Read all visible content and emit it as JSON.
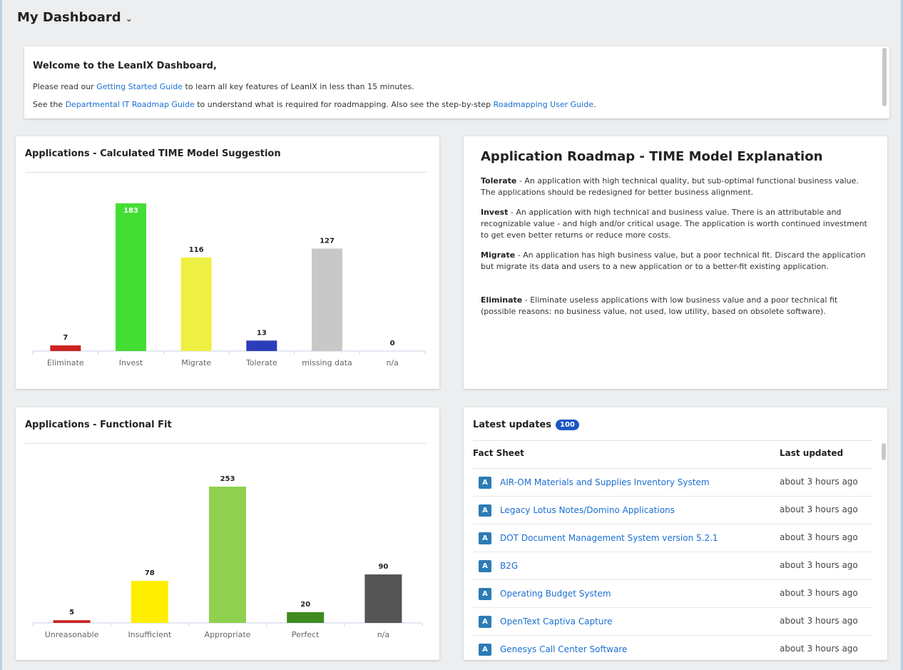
{
  "header": {
    "title": "My Dashboard",
    "chevron_icon": "chevron-down-icon"
  },
  "welcome": {
    "title": "Welcome to the LeanIX Dashboard,",
    "line1_pre": "Please read our ",
    "line1_link": "Getting Started Guide",
    "line1_post": " to learn all key features of LeanIX in less than 15 minutes.",
    "line2_pre": "See the ",
    "line2_link1": "Departmental IT Roadmap Guide",
    "line2_mid": " to understand what is required for roadmapping. Also see the step-by-step ",
    "line2_link2": "Roadmapping User Guide",
    "line2_post": "."
  },
  "time_chart": {
    "title": "Applications - Calculated TIME Model Suggestion"
  },
  "ff_chart": {
    "title": "Applications - Functional Fit"
  },
  "chart_data": [
    {
      "type": "bar",
      "title": "Applications - Calculated TIME Model Suggestion",
      "categories": [
        "Eliminate",
        "Invest",
        "Migrate",
        "Tolerate",
        "missing data",
        "n/a"
      ],
      "values": [
        7,
        183,
        116,
        13,
        127,
        0
      ],
      "colors": [
        "#cc2222",
        "#44dd33",
        "#eef044",
        "#2c3dbb",
        "#c8c8c8",
        "#c8c8c8"
      ],
      "ylim": [
        0,
        183
      ]
    },
    {
      "type": "bar",
      "title": "Applications - Functional Fit",
      "categories": [
        "Unreasonable",
        "Insufficient",
        "Appropriate",
        "Perfect",
        "n/a"
      ],
      "values": [
        5,
        78,
        253,
        20,
        90
      ],
      "colors": [
        "#cc2222",
        "#ffee00",
        "#8fd14f",
        "#3f8a1f",
        "#555555"
      ],
      "ylim": [
        0,
        253
      ]
    }
  ],
  "explain": {
    "title": "Application Roadmap - TIME Model Explanation",
    "items": [
      {
        "term": "Tolerate",
        "text": " - An application with high technical quality, but sub-optimal functional business value. The applications should be redesigned for better business alignment."
      },
      {
        "term": "Invest",
        "text": " - An application with high technical and business value. There is an attributable and recognizable value - and high and/or critical usage. The application is worth continued investment to get even better returns or reduce more costs."
      },
      {
        "term": "Migrate",
        "text": " - An application has high business value, but a poor technical fit. Discard the application but migrate its data and users to a new application or to a better-fit existing application."
      },
      {
        "term": "Eliminate",
        "text": " - Eliminate useless applications with low business value and a poor technical fit (possible reasons: no business value, not used, low utility, based on obsolete software)."
      }
    ]
  },
  "updates": {
    "title": "Latest updates",
    "count": "100",
    "col_factsheet": "Fact Sheet",
    "col_updated": "Last updated",
    "icon_letter": "A",
    "rows": [
      {
        "name": "AIR-OM Materials and Supplies Inventory System",
        "time": "about 3 hours ago"
      },
      {
        "name": "Legacy Lotus Notes/Domino Applications",
        "time": "about 3 hours ago"
      },
      {
        "name": "DOT Document Management System version 5.2.1",
        "time": "about 3 hours ago"
      },
      {
        "name": "B2G",
        "time": "about 3 hours ago"
      },
      {
        "name": "Operating Budget System",
        "time": "about 3 hours ago"
      },
      {
        "name": "OpenText Captiva Capture",
        "time": "about 3 hours ago"
      },
      {
        "name": "Genesys Call Center Software",
        "time": "about 3 hours ago"
      }
    ]
  }
}
